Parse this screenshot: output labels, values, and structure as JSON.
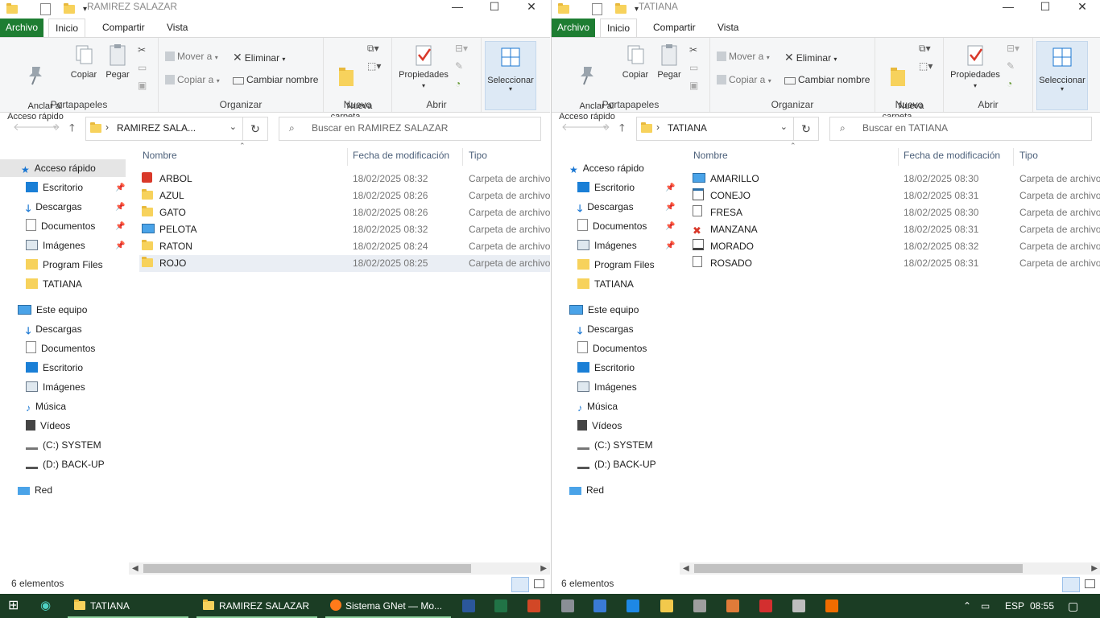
{
  "left": {
    "title": "RAMIREZ SALAZAR",
    "tabs": {
      "file": "Archivo",
      "home": "Inicio",
      "share": "Compartir",
      "view": "Vista"
    },
    "address_path": "RAMIREZ SALA...",
    "search_placeholder": "Buscar en RAMIREZ SALAZAR",
    "files": [
      {
        "name": "ARBOL",
        "date": "18/02/2025 08:32",
        "type": "Carpeta de archivos",
        "icon": "red-app-icon"
      },
      {
        "name": "AZUL",
        "date": "18/02/2025 08:26",
        "type": "Carpeta de archivos",
        "icon": "folder-icon"
      },
      {
        "name": "GATO",
        "date": "18/02/2025 08:26",
        "type": "Carpeta de archivos",
        "icon": "folder-icon"
      },
      {
        "name": "PELOTA",
        "date": "18/02/2025 08:32",
        "type": "Carpeta de archivos",
        "icon": "monitor-icon"
      },
      {
        "name": "RATON",
        "date": "18/02/2025 08:24",
        "type": "Carpeta de archivos",
        "icon": "folder-icon"
      },
      {
        "name": "ROJO",
        "date": "18/02/2025 08:25",
        "type": "Carpeta de archivos",
        "icon": "folder-icon"
      }
    ],
    "status": "6 elementos"
  },
  "right": {
    "title": "TATIANA",
    "tabs": {
      "file": "Archivo",
      "home": "Inicio",
      "share": "Compartir",
      "view": "Vista"
    },
    "address_path": "TATIANA",
    "search_placeholder": "Buscar en TATIANA",
    "files": [
      {
        "name": "AMARILLO",
        "date": "18/02/2025 08:30",
        "type": "Carpeta de archivos",
        "icon": "monitor-icon"
      },
      {
        "name": "CONEJO",
        "date": "18/02/2025 08:31",
        "type": "Carpeta de archivos",
        "icon": "window-icon"
      },
      {
        "name": "FRESA",
        "date": "18/02/2025 08:30",
        "type": "Carpeta de archivos",
        "icon": "document-icon"
      },
      {
        "name": "MANZANA",
        "date": "18/02/2025 08:31",
        "type": "Carpeta de archivos",
        "icon": "red-x-icon"
      },
      {
        "name": "MORADO",
        "date": "18/02/2025 08:32",
        "type": "Carpeta de archivos",
        "icon": "drive-icon"
      },
      {
        "name": "ROSADO",
        "date": "18/02/2025 08:31",
        "type": "Carpeta de archivos",
        "icon": "document-icon"
      }
    ],
    "status": "6 elementos"
  },
  "ribbon": {
    "pin": "Anclar al\nAcceso rápido",
    "copy": "Copiar",
    "paste": "Pegar",
    "group_clipboard": "Portapapeles",
    "move_to": "Mover a",
    "copy_to": "Copiar a",
    "delete": "Eliminar",
    "rename": "Cambiar nombre",
    "group_organize": "Organizar",
    "new_folder": "Nueva\ncarpeta",
    "group_new": "Nuevo",
    "properties": "Propiedades",
    "group_open": "Abrir",
    "select": "Seleccionar"
  },
  "columns": {
    "name": "Nombre",
    "date": "Fecha de modificación",
    "type": "Tipo"
  },
  "nav": {
    "quick_access": "Acceso rápido",
    "quick_items": [
      "Escritorio",
      "Descargas",
      "Documentos",
      "Imágenes",
      "Program Files",
      "TATIANA"
    ],
    "this_pc": "Este equipo",
    "pc_items": [
      "Descargas",
      "Documentos",
      "Escritorio",
      "Imágenes",
      "Música",
      "Vídeos",
      "(C:) SYSTEM",
      "(D:) BACK-UP"
    ],
    "network": "Red"
  },
  "taskbar": {
    "items": [
      "TATIANA",
      "RAMIREZ SALAZAR",
      "Sistema GNet — Mo..."
    ],
    "lang": "ESP",
    "time": "08:55"
  },
  "colors": {
    "file_tab": "#1e7d32",
    "taskbar": "#1b3d24",
    "selection": "#dde9f5",
    "folder": "#f7d25c"
  }
}
